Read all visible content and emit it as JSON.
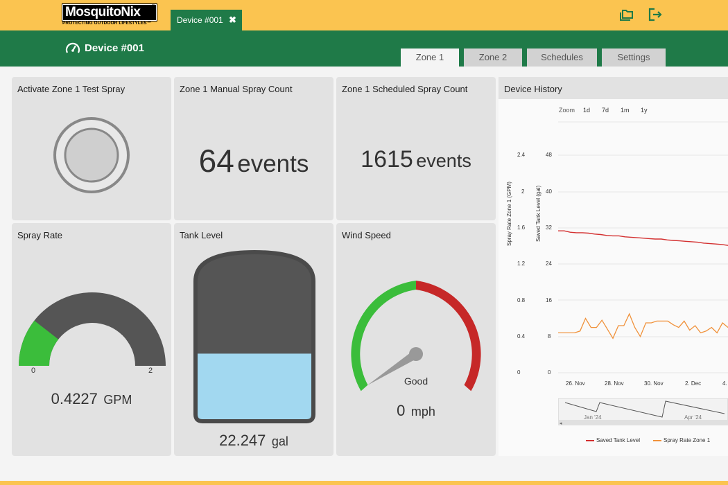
{
  "brand": {
    "logo": "MosquitoNix",
    "registered": "®",
    "tagline": "PROTECTING OUTDOOR LIFESTYLES™"
  },
  "header": {
    "device_tab_label": "Device #001",
    "device_tab_close": "✖",
    "page_title": "Device #001",
    "tabs": [
      {
        "label": "Zone 1",
        "active": true
      },
      {
        "label": "Zone 2",
        "active": false
      },
      {
        "label": "Schedules",
        "active": false
      },
      {
        "label": "Settings",
        "active": false
      }
    ],
    "icons": [
      "folders-icon",
      "logout-icon"
    ]
  },
  "cards": {
    "test_spray": {
      "title": "Activate Zone 1 Test Spray"
    },
    "manual_count": {
      "title": "Zone 1 Manual Spray Count",
      "value": "64",
      "unit": "events"
    },
    "scheduled_count": {
      "title": "Zone 1 Scheduled Spray Count",
      "value": "1615",
      "unit": "events"
    },
    "spray_rate": {
      "title": "Spray Rate",
      "value": "0.4227",
      "unit": "GPM",
      "min": "0",
      "max": "2",
      "fraction": 0.2114
    },
    "tank_level": {
      "title": "Tank Level",
      "value": "22.247",
      "unit": "gal",
      "fill_fraction": 0.4
    },
    "wind_speed": {
      "title": "Wind Speed",
      "value": "0",
      "unit": "mph",
      "status": "Good"
    }
  },
  "history": {
    "title": "Device History",
    "zoom_label": "Zoom",
    "zoom_options": [
      "1d",
      "7d",
      "1m",
      "1y"
    ],
    "navigator_labels": [
      "Jan '24",
      "Apr '24"
    ],
    "colors": {
      "tank": "#d32f2f",
      "spray": "#f0913a"
    },
    "chart_data": {
      "type": "line",
      "title": "",
      "x_ticks": [
        "26. Nov",
        "28. Nov",
        "30. Nov",
        "2. Dec",
        "4."
      ],
      "y_left": {
        "label": "Spray Rate Zone 1 (GPM)",
        "ticks": [
          "0",
          "0.4",
          "0.8",
          "1.2",
          "1.6",
          "2",
          "2.4"
        ],
        "range": [
          0,
          2.4
        ]
      },
      "y_right": {
        "label": "Saved Tank Level (gal)",
        "ticks": [
          "0",
          "8",
          "16",
          "24",
          "32",
          "40",
          "48"
        ],
        "range": [
          0,
          48
        ]
      },
      "series": [
        {
          "name": "Saved Tank Level",
          "axis": "right",
          "values": [
            31.3,
            31.3,
            31.0,
            30.9,
            30.9,
            30.8,
            30.6,
            30.5,
            30.3,
            30.2,
            30.2,
            30.0,
            29.9,
            29.8,
            29.7,
            29.6,
            29.5,
            29.5,
            29.3,
            29.2,
            29.1,
            29.0,
            28.9,
            28.8,
            28.6,
            28.5,
            28.4,
            28.3,
            28.1
          ]
        },
        {
          "name": "Spray Rate Zone 1",
          "axis": "left",
          "values": [
            0.44,
            0.44,
            0.44,
            0.44,
            0.46,
            0.6,
            0.5,
            0.5,
            0.58,
            0.48,
            0.38,
            0.52,
            0.52,
            0.65,
            0.5,
            0.4,
            0.55,
            0.55,
            0.57,
            0.57,
            0.57,
            0.53,
            0.5,
            0.57,
            0.47,
            0.52,
            0.44,
            0.46,
            0.5,
            0.44,
            0.55,
            0.5
          ]
        }
      ]
    },
    "legend": [
      "Saved Tank Level",
      "Spray Rate Zone 1"
    ]
  }
}
